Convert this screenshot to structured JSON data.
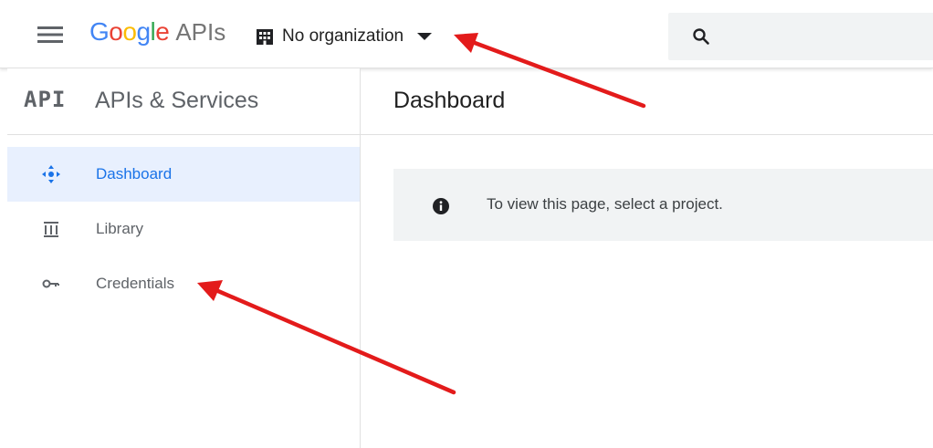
{
  "header": {
    "menu_icon": "hamburger-menu-icon",
    "logo": {
      "google_letters": [
        "G",
        "o",
        "o",
        "g",
        "l",
        "e"
      ],
      "google_colors": [
        "#4285F4",
        "#EA4335",
        "#FBBC05",
        "#4285F4",
        "#34A853",
        "#EA4335"
      ],
      "suffix": "APIs"
    },
    "org_picker": {
      "icon": "building-icon",
      "label": "No organization",
      "caret_icon": "caret-down-icon"
    },
    "search": {
      "icon": "search-icon"
    }
  },
  "sidebar": {
    "badge": "API",
    "title": "APIs & Services",
    "items": [
      {
        "label": "Dashboard",
        "icon": "dashboard-icon",
        "active": true
      },
      {
        "label": "Library",
        "icon": "library-icon",
        "active": false
      },
      {
        "label": "Credentials",
        "icon": "key-icon",
        "active": false
      }
    ]
  },
  "main": {
    "title": "Dashboard",
    "notice": {
      "icon": "info-icon",
      "text": "To view this page, select a project."
    }
  },
  "annotations": {
    "arrow_color": "#e31b1b"
  },
  "colors": {
    "active_bg": "#e8f0fe",
    "active_text": "#1a73e8",
    "muted_text": "#5f6368"
  }
}
